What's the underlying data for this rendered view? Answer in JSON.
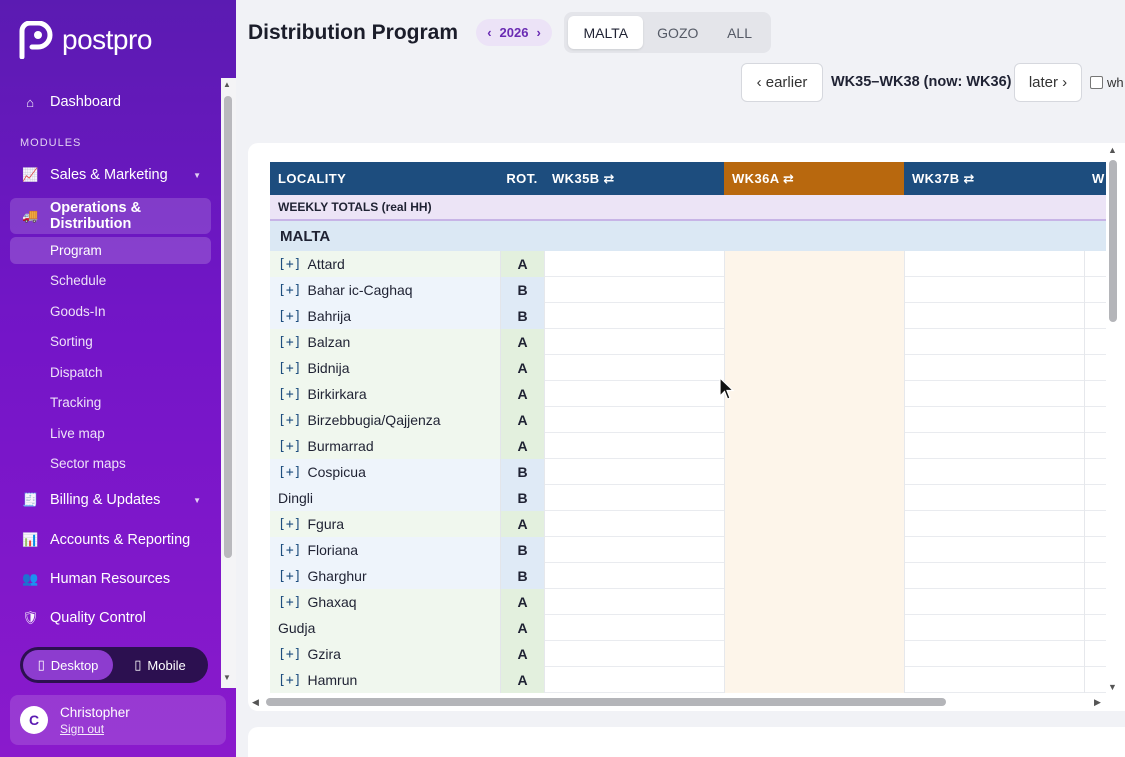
{
  "app": {
    "name": "postpro"
  },
  "sidebar": {
    "dashboard": "Dashboard",
    "modules_label": "MODULES",
    "sales": "Sales & Marketing",
    "operations": "Operations & Distribution",
    "sub_items": [
      "Program",
      "Schedule",
      "Goods-In",
      "Sorting",
      "Dispatch",
      "Tracking",
      "Live map",
      "Sector maps"
    ],
    "billing": "Billing & Updates",
    "accounts": "Accounts & Reporting",
    "hr": "Human Resources",
    "qc": "Quality Control",
    "view_desktop": "Desktop",
    "view_mobile": "Mobile",
    "user_initial": "C",
    "user_name": "Christopher",
    "sign_out": "Sign out"
  },
  "header": {
    "title": "Distribution Program",
    "year": "2026",
    "year_prev": "‹",
    "year_next": "›",
    "tabs": [
      "MALTA",
      "GOZO",
      "ALL"
    ],
    "active_tab": "MALTA",
    "earlier": "‹ earlier",
    "later": "later ›",
    "week_range": "WK35–WK38 (now: WK36)",
    "checkbox_label": "wh"
  },
  "table": {
    "col_locality": "LOCALITY",
    "col_rot": "ROT.",
    "week_cols": [
      "WK35B ⇄",
      "WK36A ⇄",
      "WK37B ⇄",
      "W"
    ],
    "current_week_index": 1,
    "weekly_totals": "WEEKLY TOTALS (real HH)",
    "region": "MALTA",
    "rows": [
      {
        "expand": "[+]",
        "name": "Attard",
        "rot": "A"
      },
      {
        "expand": "[+]",
        "name": "Bahar ic-Caghaq",
        "rot": "B"
      },
      {
        "expand": "[+]",
        "name": "Bahrija",
        "rot": "B"
      },
      {
        "expand": "[+]",
        "name": "Balzan",
        "rot": "A"
      },
      {
        "expand": "[+]",
        "name": "Bidnija",
        "rot": "A"
      },
      {
        "expand": "[+]",
        "name": "Birkirkara",
        "rot": "A"
      },
      {
        "expand": "[+]",
        "name": "Birzebbugia/Qajjenza",
        "rot": "A"
      },
      {
        "expand": "[+]",
        "name": "Burmarrad",
        "rot": "A"
      },
      {
        "expand": "[+]",
        "name": "Cospicua",
        "rot": "B"
      },
      {
        "expand": "",
        "name": "Dingli",
        "rot": "B"
      },
      {
        "expand": "[+]",
        "name": "Fgura",
        "rot": "A"
      },
      {
        "expand": "[+]",
        "name": "Floriana",
        "rot": "B"
      },
      {
        "expand": "[+]",
        "name": "Gharghur",
        "rot": "B"
      },
      {
        "expand": "[+]",
        "name": "Ghaxaq",
        "rot": "A"
      },
      {
        "expand": "",
        "name": "Gudja",
        "rot": "A"
      },
      {
        "expand": "[+]",
        "name": "Gzira",
        "rot": "A"
      },
      {
        "expand": "[+]",
        "name": "Hamrun",
        "rot": "A"
      }
    ]
  }
}
